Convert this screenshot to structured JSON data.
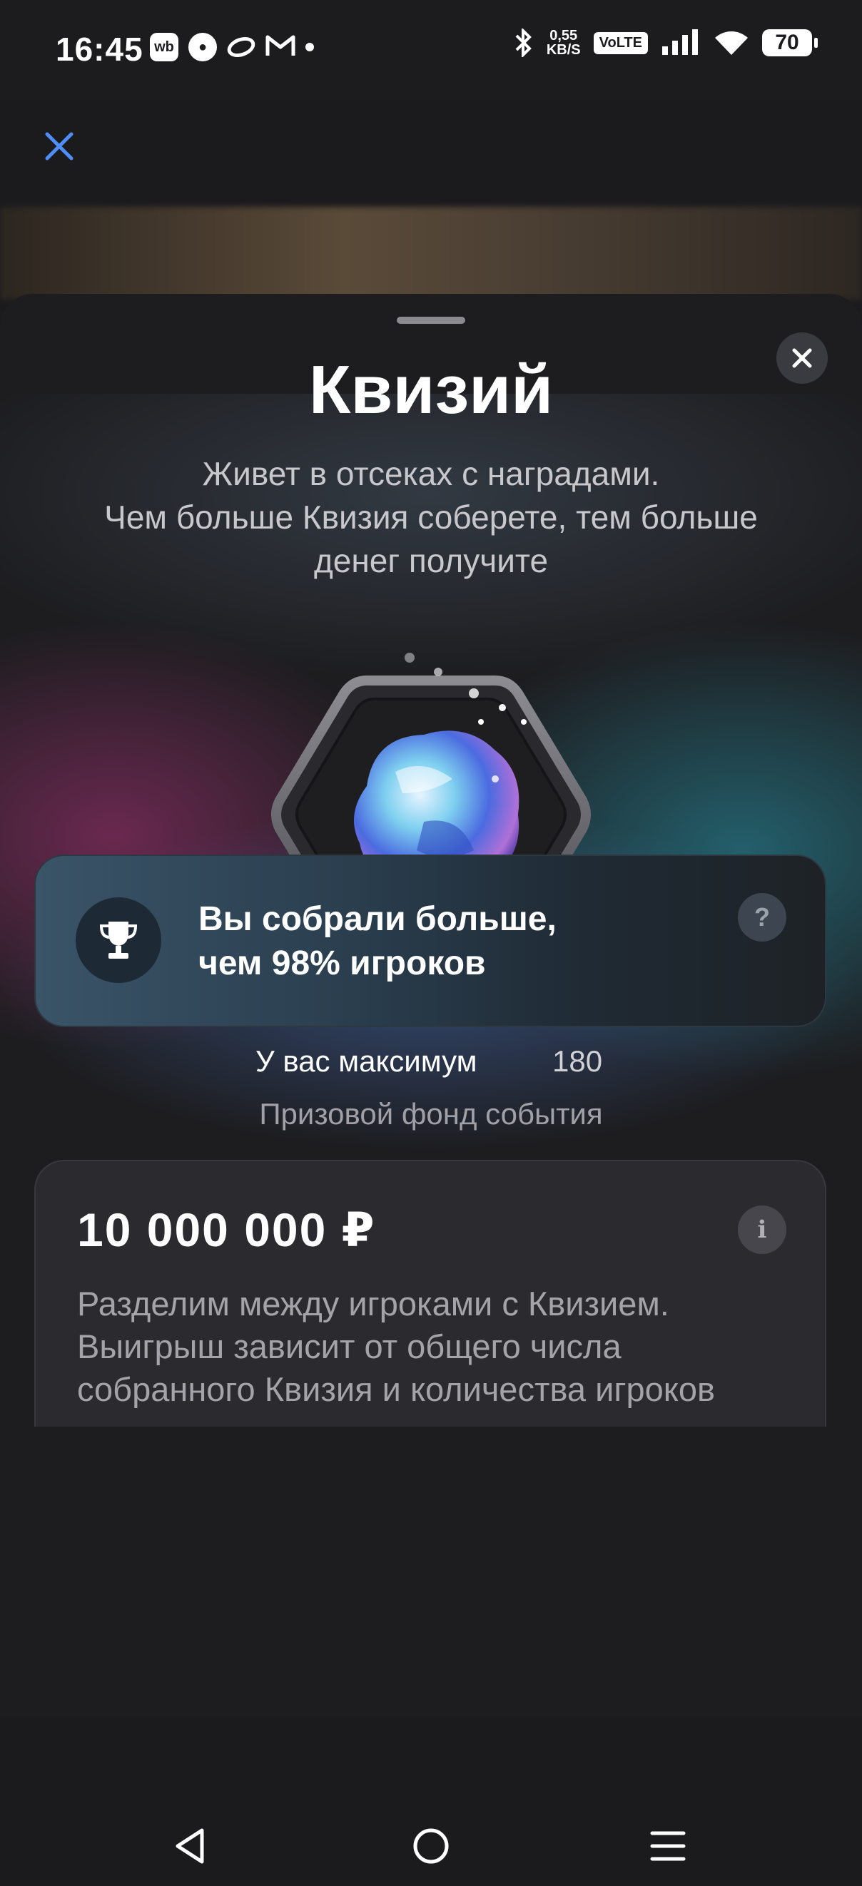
{
  "status_bar": {
    "time": "16:45",
    "notification_icons": [
      "wb-icon",
      "chat-icon",
      "oval-icon",
      "gmail-icon"
    ],
    "net_speed_value": "0,55",
    "net_speed_unit": "KB/S",
    "volte": "VoLTE",
    "battery": "70"
  },
  "sheet": {
    "title": "Квизий",
    "description_lines": [
      "Живет в отсеках с наградами.",
      "Чем больше Квизия соберете, тем больше",
      "денег получите"
    ],
    "progress_fill": 1.0,
    "max_label": "У вас максимум",
    "max_value": "180"
  },
  "stat_card": {
    "line1": "Вы собрали больше,",
    "line2": "чем 98% игроков",
    "help_symbol": "?"
  },
  "prize_fund": {
    "label": "Призовой фонд события",
    "amount": "10 000 000 ₽",
    "info_symbol": "i",
    "description_lines": [
      "Разделим между игроками с Квизием.",
      "Выигрыш зависит от общего числа",
      "собранного Квизия и количества игроков"
    ]
  },
  "colors": {
    "accent_close": "#4f8ef7",
    "progress_start": "#79c3dd",
    "progress_end": "#e78ad8"
  }
}
